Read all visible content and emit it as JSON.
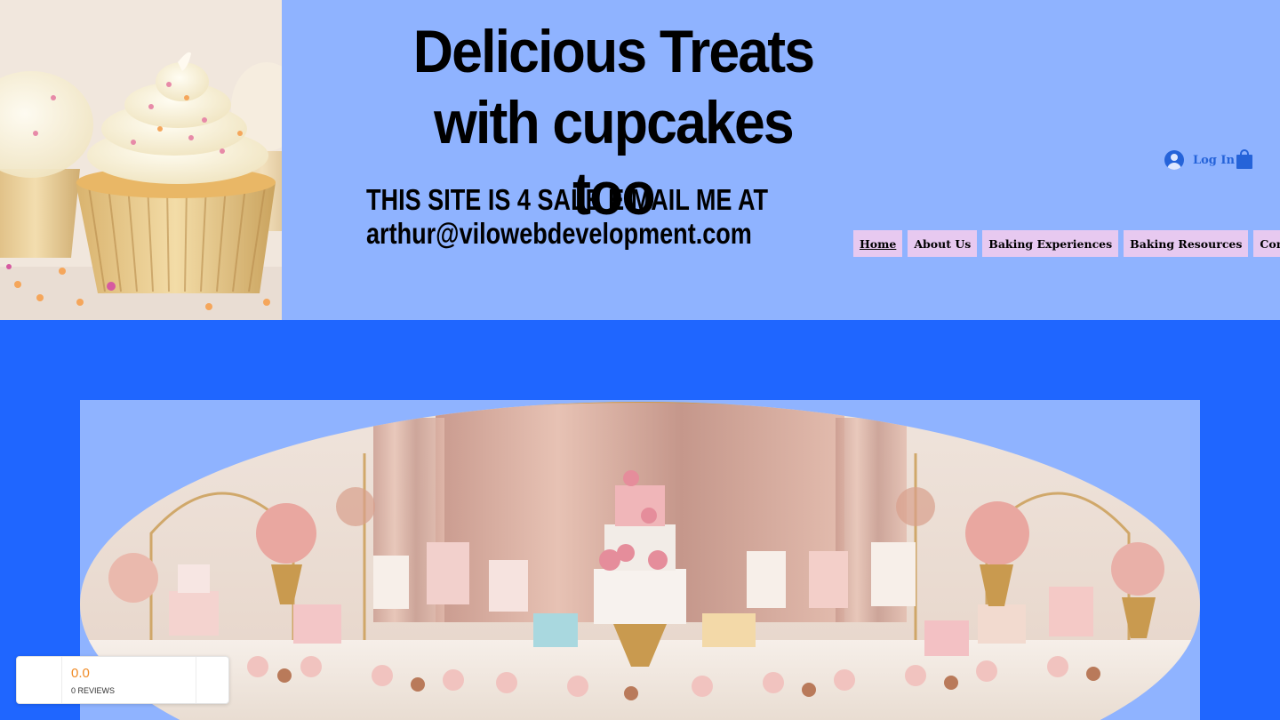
{
  "header": {
    "title_line1": "Delicious Treats",
    "title_line2": "with cupcakes too",
    "sale_line1": "THIS SITE IS 4 SALE E MAIL ME AT",
    "sale_line2": "arthur@vilowebdevelopment.com",
    "login_label": "Log In",
    "accent_color": "#2563d9",
    "background_color": "#8fb3ff"
  },
  "nav": {
    "items": [
      {
        "label": "Home",
        "active": true
      },
      {
        "label": "About Us"
      },
      {
        "label": "Baking Experiences"
      },
      {
        "label": "Baking Resources"
      },
      {
        "label": "Contact Us"
      }
    ],
    "item_color": "#e7c9f0"
  },
  "page": {
    "background_color": "#1f66ff"
  },
  "reviews_widget": {
    "score": "0.0",
    "count_label": "0 REVIEWS",
    "score_color": "#f08a24"
  },
  "icons": [
    "avatar-icon",
    "shopping-bag-icon"
  ]
}
